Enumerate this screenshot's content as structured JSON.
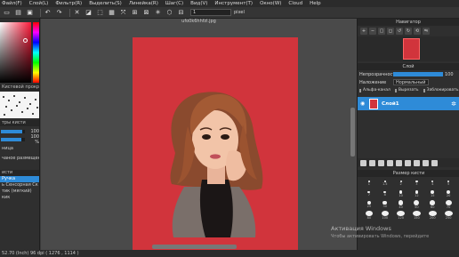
{
  "menu": [
    "Файл(F)",
    "Слой(L)",
    "Фильтр(R)",
    "Выделить(S)",
    "Линейка(R)",
    "Шаг(C)",
    "Вид(V)",
    "Инструмент(T)",
    "Окно(W)",
    "Cloud",
    "Help"
  ],
  "toolbar": {
    "zoom_value": "1",
    "unit": "pixel"
  },
  "document": {
    "title": "ufo0k6hhfzl.jpg"
  },
  "left_panel": {
    "brush_preview_label": "Кистевой прокрутки п...",
    "params_label": "тры кисти",
    "size_value": "100",
    "opacity_value": "100 %",
    "line_label": "ница",
    "placement_label": "чаное размещени",
    "brush_list_label": "исти",
    "brush_items": [
      "Ручка",
      "ь Сенсорная Ск",
      "тик (мягкий)",
      "кик"
    ]
  },
  "navigator": {
    "title": "Навигатор"
  },
  "layers_panel": {
    "title": "Слой",
    "opacity_label": "Непрозрачность",
    "opacity_value": "100",
    "blend_label": "Наложение",
    "blend_value": "Нормальный",
    "alpha_label": "Альфа-канал",
    "clip_label": "Вырезать",
    "lock_label": "Заблокировать",
    "layer_name": "Слой1"
  },
  "brush_size": {
    "title": "Размер кисти",
    "sizes": [
      "1",
      "1.5",
      "2",
      "3",
      "4",
      "5",
      "7",
      "8",
      "10",
      "12",
      "15",
      "20",
      "25",
      "30",
      "40",
      "50",
      "60",
      "70",
      "80",
      "100",
      "120",
      "150",
      "200",
      "250"
    ]
  },
  "activation": {
    "line1": "Активация Windows",
    "line2": "Чтобы активировать Windows, перейдите"
  },
  "status": "52.70 (Inch)  96 dpi  ( 1276 , 1114 )"
}
